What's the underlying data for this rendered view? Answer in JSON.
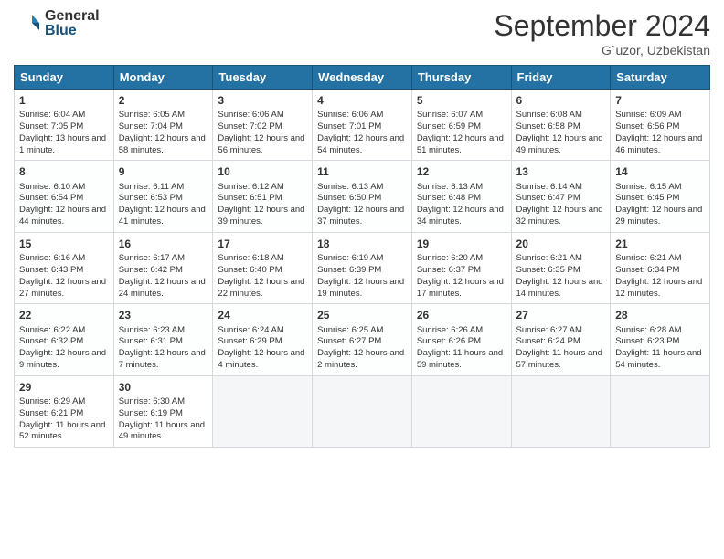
{
  "logo": {
    "general": "General",
    "blue": "Blue"
  },
  "title": "September 2024",
  "location": "G`uzor, Uzbekistan",
  "days_header": [
    "Sunday",
    "Monday",
    "Tuesday",
    "Wednesday",
    "Thursday",
    "Friday",
    "Saturday"
  ],
  "cells": [
    {
      "day": "1",
      "sunrise": "6:04 AM",
      "sunset": "7:05 PM",
      "daylight": "Daylight: 13 hours and 1 minute."
    },
    {
      "day": "2",
      "sunrise": "6:05 AM",
      "sunset": "7:04 PM",
      "daylight": "Daylight: 12 hours and 58 minutes."
    },
    {
      "day": "3",
      "sunrise": "6:06 AM",
      "sunset": "7:02 PM",
      "daylight": "Daylight: 12 hours and 56 minutes."
    },
    {
      "day": "4",
      "sunrise": "6:06 AM",
      "sunset": "7:01 PM",
      "daylight": "Daylight: 12 hours and 54 minutes."
    },
    {
      "day": "5",
      "sunrise": "6:07 AM",
      "sunset": "6:59 PM",
      "daylight": "Daylight: 12 hours and 51 minutes."
    },
    {
      "day": "6",
      "sunrise": "6:08 AM",
      "sunset": "6:58 PM",
      "daylight": "Daylight: 12 hours and 49 minutes."
    },
    {
      "day": "7",
      "sunrise": "6:09 AM",
      "sunset": "6:56 PM",
      "daylight": "Daylight: 12 hours and 46 minutes."
    },
    {
      "day": "8",
      "sunrise": "6:10 AM",
      "sunset": "6:54 PM",
      "daylight": "Daylight: 12 hours and 44 minutes."
    },
    {
      "day": "9",
      "sunrise": "6:11 AM",
      "sunset": "6:53 PM",
      "daylight": "Daylight: 12 hours and 41 minutes."
    },
    {
      "day": "10",
      "sunrise": "6:12 AM",
      "sunset": "6:51 PM",
      "daylight": "Daylight: 12 hours and 39 minutes."
    },
    {
      "day": "11",
      "sunrise": "6:13 AM",
      "sunset": "6:50 PM",
      "daylight": "Daylight: 12 hours and 37 minutes."
    },
    {
      "day": "12",
      "sunrise": "6:13 AM",
      "sunset": "6:48 PM",
      "daylight": "Daylight: 12 hours and 34 minutes."
    },
    {
      "day": "13",
      "sunrise": "6:14 AM",
      "sunset": "6:47 PM",
      "daylight": "Daylight: 12 hours and 32 minutes."
    },
    {
      "day": "14",
      "sunrise": "6:15 AM",
      "sunset": "6:45 PM",
      "daylight": "Daylight: 12 hours and 29 minutes."
    },
    {
      "day": "15",
      "sunrise": "6:16 AM",
      "sunset": "6:43 PM",
      "daylight": "Daylight: 12 hours and 27 minutes."
    },
    {
      "day": "16",
      "sunrise": "6:17 AM",
      "sunset": "6:42 PM",
      "daylight": "Daylight: 12 hours and 24 minutes."
    },
    {
      "day": "17",
      "sunrise": "6:18 AM",
      "sunset": "6:40 PM",
      "daylight": "Daylight: 12 hours and 22 minutes."
    },
    {
      "day": "18",
      "sunrise": "6:19 AM",
      "sunset": "6:39 PM",
      "daylight": "Daylight: 12 hours and 19 minutes."
    },
    {
      "day": "19",
      "sunrise": "6:20 AM",
      "sunset": "6:37 PM",
      "daylight": "Daylight: 12 hours and 17 minutes."
    },
    {
      "day": "20",
      "sunrise": "6:21 AM",
      "sunset": "6:35 PM",
      "daylight": "Daylight: 12 hours and 14 minutes."
    },
    {
      "day": "21",
      "sunrise": "6:21 AM",
      "sunset": "6:34 PM",
      "daylight": "Daylight: 12 hours and 12 minutes."
    },
    {
      "day": "22",
      "sunrise": "6:22 AM",
      "sunset": "6:32 PM",
      "daylight": "Daylight: 12 hours and 9 minutes."
    },
    {
      "day": "23",
      "sunrise": "6:23 AM",
      "sunset": "6:31 PM",
      "daylight": "Daylight: 12 hours and 7 minutes."
    },
    {
      "day": "24",
      "sunrise": "6:24 AM",
      "sunset": "6:29 PM",
      "daylight": "Daylight: 12 hours and 4 minutes."
    },
    {
      "day": "25",
      "sunrise": "6:25 AM",
      "sunset": "6:27 PM",
      "daylight": "Daylight: 12 hours and 2 minutes."
    },
    {
      "day": "26",
      "sunrise": "6:26 AM",
      "sunset": "6:26 PM",
      "daylight": "Daylight: 11 hours and 59 minutes."
    },
    {
      "day": "27",
      "sunrise": "6:27 AM",
      "sunset": "6:24 PM",
      "daylight": "Daylight: 11 hours and 57 minutes."
    },
    {
      "day": "28",
      "sunrise": "6:28 AM",
      "sunset": "6:23 PM",
      "daylight": "Daylight: 11 hours and 54 minutes."
    },
    {
      "day": "29",
      "sunrise": "6:29 AM",
      "sunset": "6:21 PM",
      "daylight": "Daylight: 11 hours and 52 minutes."
    },
    {
      "day": "30",
      "sunrise": "6:30 AM",
      "sunset": "6:19 PM",
      "daylight": "Daylight: 11 hours and 49 minutes."
    }
  ]
}
